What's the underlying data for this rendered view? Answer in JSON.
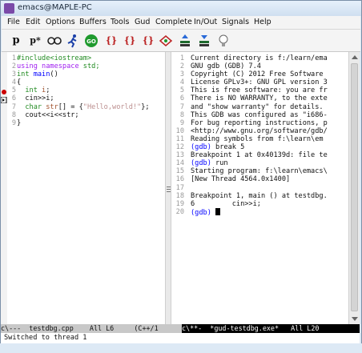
{
  "window": {
    "title": "emacs@MAPLE-PC"
  },
  "menubar": {
    "items": [
      "File",
      "Edit",
      "Options",
      "Buffers",
      "Tools",
      "Gud",
      "Complete",
      "In/Out",
      "Signals",
      "Help"
    ]
  },
  "toolbar": {
    "buttons": [
      {
        "label": "p",
        "name": "print-button"
      },
      {
        "label": "p*",
        "name": "print-star-button"
      },
      {
        "label": "",
        "name": "watch-button"
      },
      {
        "label": "",
        "name": "run-button"
      },
      {
        "label": "GO",
        "name": "go-button"
      },
      {
        "label": "{}",
        "name": "step-button"
      },
      {
        "label": "{}",
        "name": "next-button"
      },
      {
        "label": "{}",
        "name": "until-button"
      },
      {
        "label": "",
        "name": "finish-button"
      },
      {
        "label": "",
        "name": "up-button"
      },
      {
        "label": "",
        "name": "down-button"
      },
      {
        "label": "",
        "name": "help-button"
      }
    ]
  },
  "source_pane": {
    "line_numbers": [
      "1",
      "2",
      "3",
      "4",
      "5",
      "6",
      "7",
      "8",
      "9"
    ],
    "lines": [
      {
        "parts": [
          {
            "t": "#include<iostream>",
            "c": "tp"
          }
        ]
      },
      {
        "parts": [
          {
            "t": "using ",
            "c": "kw"
          },
          {
            "t": "namespace ",
            "c": "kw"
          },
          {
            "t": "std;",
            "c": "tp"
          }
        ]
      },
      {
        "parts": [
          {
            "t": "int ",
            "c": "tp"
          },
          {
            "t": "main",
            "c": "prompt"
          },
          {
            "t": "()",
            "c": ""
          }
        ]
      },
      {
        "parts": [
          {
            "t": "{",
            "c": ""
          }
        ]
      },
      {
        "parts": [
          {
            "t": "  int ",
            "c": "tp"
          },
          {
            "t": "i",
            "c": "var"
          },
          {
            "t": ";",
            "c": ""
          }
        ]
      },
      {
        "parts": [
          {
            "t": "  cin>>i;",
            "c": ""
          }
        ]
      },
      {
        "parts": [
          {
            "t": "  char ",
            "c": "tp"
          },
          {
            "t": "str",
            "c": "var"
          },
          {
            "t": "[] = {",
            "c": ""
          },
          {
            "t": "\"Hello,world!\"",
            "c": "str"
          },
          {
            "t": "};",
            "c": ""
          }
        ]
      },
      {
        "parts": [
          {
            "t": "  cout<<i<<str;",
            "c": ""
          }
        ]
      },
      {
        "parts": [
          {
            "t": "}",
            "c": ""
          }
        ]
      }
    ]
  },
  "gdb_pane": {
    "line_numbers": [
      "1",
      "2",
      "3",
      "4",
      "5",
      "6",
      "7",
      "8",
      "9",
      "10",
      "11",
      "12",
      "13",
      "14",
      "15",
      "16",
      "17",
      "18",
      "19",
      "20"
    ],
    "lines": [
      {
        "parts": [
          {
            "t": "Current directory is f:/learn/ema",
            "c": ""
          }
        ]
      },
      {
        "parts": [
          {
            "t": "GNU gdb (GDB) 7.4",
            "c": ""
          }
        ]
      },
      {
        "parts": [
          {
            "t": "Copyright (C) 2012 Free Software",
            "c": ""
          }
        ]
      },
      {
        "parts": [
          {
            "t": "License GPLv3+: GNU GPL version 3",
            "c": ""
          }
        ]
      },
      {
        "parts": [
          {
            "t": "This is free software: you are fr",
            "c": ""
          }
        ]
      },
      {
        "parts": [
          {
            "t": "There is NO WARRANTY, to the exte",
            "c": ""
          }
        ]
      },
      {
        "parts": [
          {
            "t": "and \"show warranty\" for details.",
            "c": ""
          }
        ]
      },
      {
        "parts": [
          {
            "t": "This GDB was configured as \"i686-",
            "c": ""
          }
        ]
      },
      {
        "parts": [
          {
            "t": "For bug reporting instructions, p",
            "c": ""
          }
        ]
      },
      {
        "parts": [
          {
            "t": "<http://www.gnu.org/software/gdb/",
            "c": ""
          }
        ]
      },
      {
        "parts": [
          {
            "t": "Reading symbols from f:\\learn\\em",
            "c": ""
          }
        ]
      },
      {
        "parts": [
          {
            "t": "(gdb) ",
            "c": "prompt"
          },
          {
            "t": "break 5",
            "c": ""
          }
        ]
      },
      {
        "parts": [
          {
            "t": "Breakpoint 1 at 0x40139d: file te",
            "c": ""
          }
        ]
      },
      {
        "parts": [
          {
            "t": "(gdb) ",
            "c": "prompt"
          },
          {
            "t": "run",
            "c": ""
          }
        ]
      },
      {
        "parts": [
          {
            "t": "Starting program: f:\\learn\\emacs\\",
            "c": ""
          }
        ]
      },
      {
        "parts": [
          {
            "t": "[New Thread 4564.0x1400]",
            "c": ""
          }
        ]
      },
      {
        "parts": [
          {
            "t": "",
            "c": ""
          }
        ]
      },
      {
        "parts": [
          {
            "t": "Breakpoint 1, main () at testdbg.",
            "c": ""
          }
        ]
      },
      {
        "parts": [
          {
            "t": "6         cin>>i;",
            "c": ""
          }
        ]
      },
      {
        "parts": [
          {
            "t": "(gdb) ",
            "c": "prompt"
          }
        ]
      }
    ]
  },
  "modeline_left": {
    "text": "c\\---  testdbg.cpp    All L6     (C++/1"
  },
  "modeline_right": {
    "text": "c\\**-  *gud-testdbg.exe*   All L20"
  },
  "echo_area": {
    "text": "Switched to thread 1"
  },
  "colors": {
    "keyword": "#a020f0",
    "type": "#228b22",
    "variable": "#a0522d",
    "string": "#bc8f8f",
    "prompt": "#0000ff",
    "breakpoint": "#cc0000"
  }
}
